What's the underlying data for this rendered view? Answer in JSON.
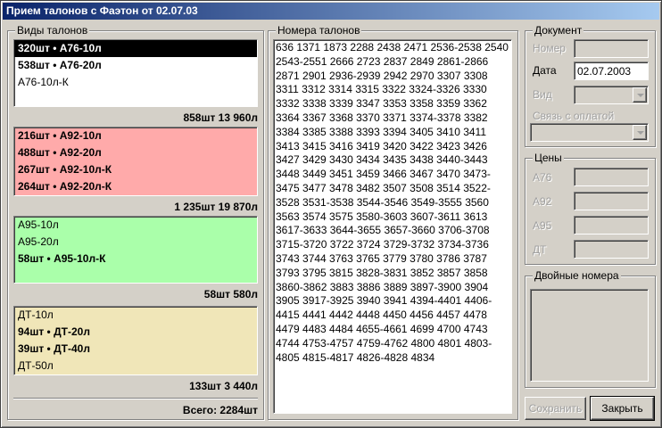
{
  "window": {
    "title": "Прием талонов с Фаэтон  от 02.07.03"
  },
  "types_group": {
    "legend": "Виды талонов",
    "groups": [
      {
        "color": "#ffffff",
        "items": [
          {
            "label": "320шт • А76-10л",
            "style": "sel"
          },
          {
            "label": "538шт • А76-20л",
            "style": "bold"
          },
          {
            "label": "А76-10л-К",
            "style": "normal"
          }
        ],
        "summary": "858шт   13 960л"
      },
      {
        "color": "#ffaaaa",
        "items": [
          {
            "label": "216шт • А92-10л",
            "style": "bold"
          },
          {
            "label": "488шт • А92-20л",
            "style": "bold"
          },
          {
            "label": "267шт • А92-10л-К",
            "style": "bold"
          },
          {
            "label": "264шт • А92-20л-К",
            "style": "bold"
          }
        ],
        "summary": "1 235шт   19 870л"
      },
      {
        "color": "#aaffaa",
        "items": [
          {
            "label": "А95-10л",
            "style": "normal"
          },
          {
            "label": "А95-20л",
            "style": "normal"
          },
          {
            "label": "58шт • А95-10л-К",
            "style": "bold"
          }
        ],
        "summary": "58шт   580л"
      },
      {
        "color": "#f0e6b8",
        "items": [
          {
            "label": "ДТ-10л",
            "style": "normal"
          },
          {
            "label": "94шт • ДТ-20л",
            "style": "bold"
          },
          {
            "label": "39шт • ДТ-40л",
            "style": "bold"
          },
          {
            "label": "ДТ-50л",
            "style": "normal"
          }
        ],
        "summary": "133шт   3 440л"
      }
    ],
    "total": "Всего:  2284шт"
  },
  "numbers_group": {
    "legend": "Номера талонов",
    "text": "636 1371 1873 2288 2438 2471 2536-2538 2540 2543-2551 2666 2723 2837 2849 2861-2866 2871 2901 2936-2939 2942 2970 3307 3308 3311 3312 3314 3315 3322 3324-3326 3330 3332 3338 3339 3347 3353 3358 3359 3362 3364 3367 3368 3370 3371 3374-3378 3382 3384 3385 3388 3393 3394 3405 3410 3411 3413 3415 3416 3419 3420 3422 3423 3426 3427 3429 3430 3434 3435 3438 3440-3443 3448 3449 3451 3459 3466 3467 3470 3473-3475 3477 3478 3482 3507 3508 3514 3522-3528 3531-3538 3544-3546 3549-3555 3560 3563 3574 3575 3580-3603 3607-3611 3613 3617-3633 3644-3655 3657-3660 3706-3708 3715-3720 3722 3724 3729-3732 3734-3736 3743 3744 3763 3765 3779 3780 3786 3787 3793 3795 3815 3828-3831 3852 3857 3858 3860-3862 3883 3886 3889 3897-3900 3904 3905 3917-3925 3940 3941 4394-4401 4406-4415 4441 4442 4448 4450 4456 4457 4478 4479 4483 4484 4655-4661 4699 4700 4743 4744 4753-4757 4759-4762 4800 4801 4803-4805 4815-4817 4826-4828 4834"
  },
  "document_group": {
    "legend": "Документ",
    "number_label": "Номер",
    "number_value": "",
    "date_label": "Дата",
    "date_value": "02.07.2003",
    "type_label": "Вид",
    "payment_label": "Связь с оплатой"
  },
  "prices_group": {
    "legend": "Цены",
    "labels": [
      "А76",
      "А92",
      "А95",
      "ДТ"
    ]
  },
  "duplicates_group": {
    "legend": "Двойные номера"
  },
  "buttons": {
    "save": "Сохранить",
    "close": "Закрыть"
  }
}
